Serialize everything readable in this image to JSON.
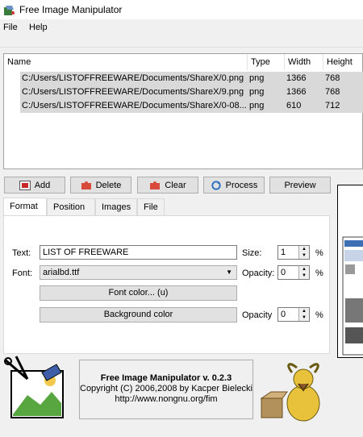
{
  "window": {
    "title": "Free Image Manipulator",
    "title_icon": "paint-bucket-icon"
  },
  "menu": {
    "items": [
      {
        "label": "File"
      },
      {
        "label": "Help"
      }
    ]
  },
  "list": {
    "columns": [
      "Name",
      "Type",
      "Width",
      "Height"
    ],
    "rows": [
      [
        "C:/Users/LISTOFFREEWARE/Documents/ShareX/0.png",
        "png",
        "1366",
        "768"
      ],
      [
        "C:/Users/LISTOFFREEWARE/Documents/ShareX/9.png",
        "png",
        "1366",
        "768"
      ],
      [
        "C:/Users/LISTOFFREEWARE/Documents/ShareX/0-08...",
        "png",
        "610",
        "712"
      ]
    ]
  },
  "toolbar": {
    "add_label": "Add",
    "delete_label": "Delete",
    "clear_label": "Clear",
    "process_label": "Process",
    "preview_label": "Preview"
  },
  "tabs": [
    {
      "label": "Format"
    },
    {
      "label": "Position"
    },
    {
      "label": "Images"
    },
    {
      "label": "File"
    }
  ],
  "format": {
    "text_label": "Text:",
    "text_value": "LIST OF FREEWARE",
    "size_label": "Size:",
    "size_value": "1",
    "size_unit": "%",
    "font_label": "Font:",
    "font_value": "arialbd.ttf",
    "opacity_label": "Opacity:",
    "opacity_value": "0",
    "opacity_unit": "%",
    "font_color_label": "Font color... (u)",
    "background_color_label": "Background color",
    "bg_opacity_label": "Opacity",
    "bg_opacity_value": "0",
    "bg_opacity_unit": "%"
  },
  "about": {
    "title": "Free Image Manipulator v. 0.2.3",
    "copyright": "Copyright (C) 2006,2008 by Kacper Bielecki",
    "url": "http://www.nongnu.org/fim"
  },
  "colors": {
    "selected_row": "#d9d9d9",
    "accent_blue": "#3c6fb4"
  }
}
